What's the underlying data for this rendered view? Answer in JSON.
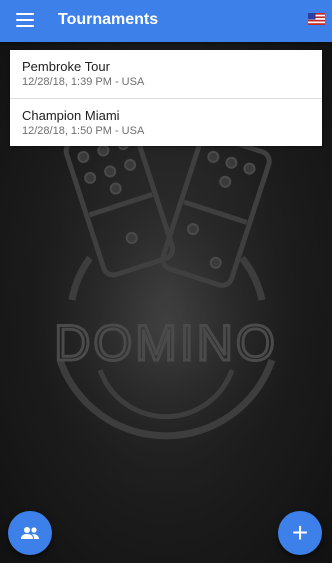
{
  "appbar": {
    "title": "Tournaments",
    "menu_icon": "menu-icon",
    "flag_icon": "us-flag-icon"
  },
  "tournaments": [
    {
      "name": "Pembroke Tour",
      "subtitle": "12/28/18, 1:39 PM - USA"
    },
    {
      "name": "Champion Miami",
      "subtitle": "12/28/18, 1:50 PM - USA"
    }
  ],
  "background": {
    "logo_text": "DOMINO"
  },
  "fabs": {
    "left_icon": "group-icon",
    "right_symbol": "+"
  },
  "colors": {
    "accent": "#3d80ea",
    "background": "#1b1b1b"
  }
}
